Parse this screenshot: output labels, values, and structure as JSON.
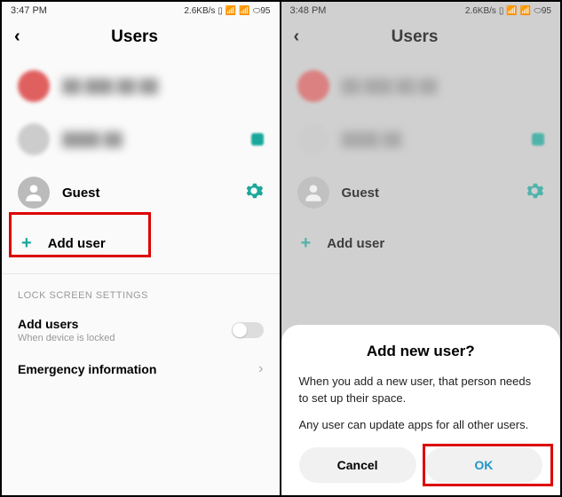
{
  "left": {
    "time": "3:47 PM",
    "net": "2.6KB/s",
    "batt": "95",
    "title": "Users",
    "guest": "Guest",
    "add": "Add user",
    "section": "LOCK SCREEN SETTINGS",
    "addUsers": {
      "title": "Add users",
      "sub": "When device is locked"
    },
    "emergency": "Emergency information"
  },
  "right": {
    "time": "3:48 PM",
    "net": "2.6KB/s",
    "batt": "95",
    "title": "Users",
    "guest": "Guest",
    "add": "Add user",
    "dialog": {
      "title": "Add new user?",
      "p1": "When you add a new user, that person needs to set up their space.",
      "p2": "Any user can update apps for all other users.",
      "cancel": "Cancel",
      "ok": "OK"
    }
  }
}
